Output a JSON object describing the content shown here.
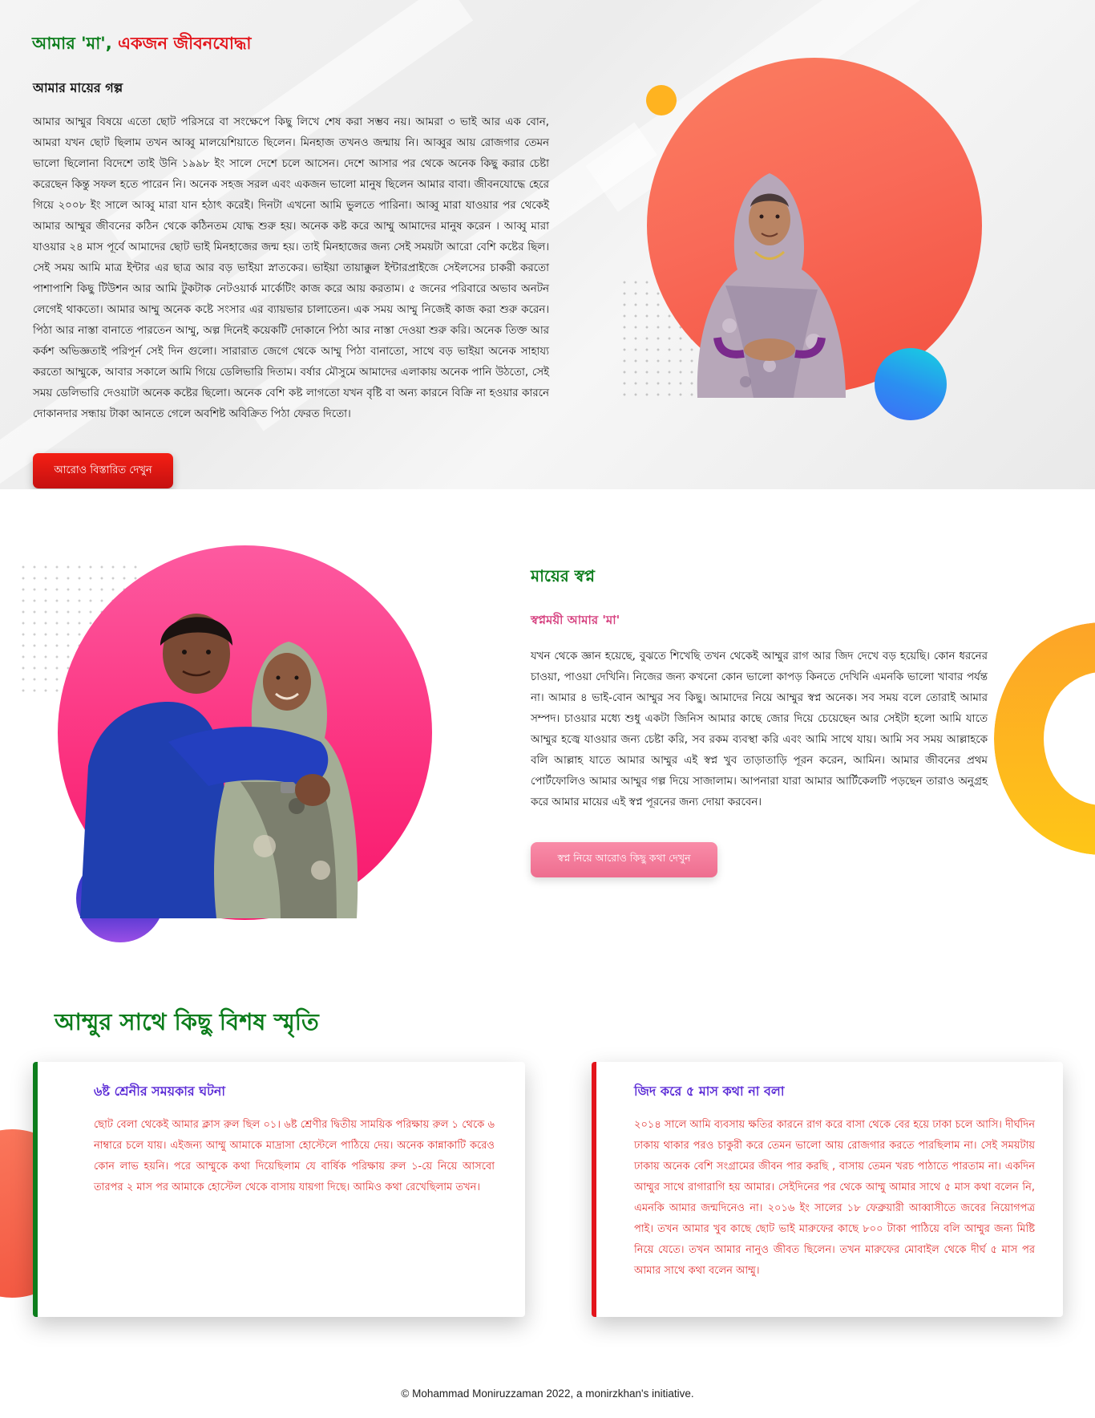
{
  "section1": {
    "headline_green": "আমার 'মা',",
    "headline_red": "একজন জীবনযোদ্ধা",
    "subtitle": "আমার মায়ের গল্প",
    "paragraph": "আমার আম্মুর বিষয়ে এতো ছোট পরিসরে বা সংক্ষেপে কিছু লিখে শেষ করা সম্ভব নয়। আমরা ৩ ভাই আর এক বোন, আমরা যখন ছোট ছিলাম তখন আব্বু মালয়েশিয়াতে ছিলেন। মিনহাজ তখনও জন্মায় নি। আব্বুর আয় রোজগার তেমন ভালো ছিলোনা বিদেশে তাই উনি ১৯৯৮ ইং সালে দেশে চলে আসেন। দেশে আসার পর থেকে অনেক কিছু করার চেষ্টা করেছেন কিন্তু সফল হতে পারেন নি। অনেক সহজ সরল এবং একজন ভালো মানুষ ছিলেন আমার বাবা। জীবনযোদ্ধে হেরে গিয়ে ২০০৮ ইং সালে আব্বু মারা যান হঠাৎ করেই। দিনটা এখনো আমি ভুলতে পারিনা। আব্বু মারা যাওয়ার পর থেকেই আমার আম্মুর জীবনের কঠিন থেকে কঠিনতম যোদ্ধ শুরু হয়। অনেক কষ্ট করে আম্মু আমাদের মানুষ করেন । আব্বু মারা যাওয়ার ২৪ মাস পূর্বে আমাদের ছোট ভাই মিনহাজের জন্ম হয়। তাই মিনহাজের জন্য সেই সময়টা আরো বেশি কষ্টের ছিল। সেই সময় আমি মাত্র ইন্টার এর ছাত্র আর বড় ভাইয়া স্নাতকের। ভাইয়া তায়াক্কুল ইন্টারপ্রাইজে সেইলসের চাকরী করতো পাশাপাশি কিছু টিউশন আর আমি টুকটাক নেটওয়ার্ক মার্কেটিং কাজ করে আয় করতাম। ৫ জনের পরিবারে অভাব অনটন লেগেই থাকতো। আমার আম্মু অনেক কষ্টে সংসার এর ব্যায়ভার চালাতেন। এক সময় আম্মু নিজেই কাজ করা শুরু করেন। পিঠা আর নাস্তা বানাতে পারতেন আম্মু, অল্প দিনেই কয়েকটি দোকানে পিঠা আর নাস্তা দেওয়া শুরু করি। অনেক তিক্ত আর কর্কশ অভিজ্ঞতাই পরিপূর্ন সেই দিন গুলো। সারারাত জেগে থেকে আম্মু পিঠা বানাতো, সাথে বড় ভাইয়া অনেক সাহায্য করতো আম্মুকে, আবার সকালে আমি গিয়ে ডেলিভারি দিতাম। বর্ষার মৌসুমে আমাদের এলাকায় অনেক পানি উঠতো, সেই সময় ডেলিভারি দেওয়াটা অনেক কষ্টের ছিলো। অনেক বেশি কষ্ট লাগতো যখন বৃষ্টি বা অন্য কারনে বিক্রি না হওয়ার কারনে দোকানদার সন্ধায় টাকা আনতে গেলে অবশিষ্ট অবিক্রিত পিঠা ফেরত দিতো।",
    "button": "আরোও বিস্তারিত দেখুন"
  },
  "section2": {
    "title": "মায়ের স্বপ্ন",
    "subtitle": "স্বপ্নময়ী আমার 'মা'",
    "paragraph": "যখন থেকে জ্ঞান হয়েছে, বুঝতে শিখেছি তখন থেকেই আম্মুর রাগ আর জিদ দেখে বড় হয়েছি। কোন ধরনের চাওয়া, পাওয়া দেখিনি। নিজের জন্য কখনো কোন ভালো কাপড় কিনতে দেখিনি এমনকি ভালো খাবার পর্যন্ত না। আমার ৪ ভাই-বোন আম্মুর সব কিছু। আমাদের নিয়ে আম্মুর স্বপ্ন অনেক। সব সময় বলে তোরাই আমার সম্পদ। চাওয়ার মধ্যে শুধু একটা জিনিস আমার কাছে জোর দিয়ে চেয়েছেন আর সেইটা হলো আমি যাতে আম্মুর হজ্বে যাওয়ার জন্য চেষ্টা করি, সব রকম ব্যবস্থা করি এবং আমি সাথে যায়। আমি সব সময় আল্লাহকে বলি আল্লাহ যাতে আমার আম্মুর এই স্বপ্ন খুব তাড়াতাড়ি পূরন করেন, আমিন। আমার জীবনের প্রথম পোর্টফোলিও আমার আম্মুর গল্প দিয়ে সাজালাম। আপনারা যারা আমার আর্টিকেলটি পড়ছেন তারাও অনুগ্রহ করে আমার মায়ের এই স্বপ্ন পূরনের জন্য দোয়া করবেন।",
    "button": "স্বপ্ন নিয়ে আরোও কিছু কথা দেখুন"
  },
  "section3": {
    "title": "আম্মুর সাথে কিছু বিশষ স্মৃতি",
    "cards": [
      {
        "title": "৬ষ্ট শ্রেনীর সময়কার ঘটনা",
        "body": "ছোট বেলা থেকেই আমার ক্লাস রুল ছিল ০১। ৬ষ্ট শ্রেণীর দ্বিতীয় সাময়িক পরিক্ষায় রুল ১ থেকে ৬ নাম্বারে চলে যায়। এইজন্য আম্মু আমাকে মাদ্রাসা হোস্টেলে পাঠিয়ে দেয়। অনেক কান্নাকাটি করেও কোন লাভ হয়নি। পরে আম্মুকে কথা দিয়েছিলাম যে বার্ষিক পরিক্ষায় রুল ১-য়ে নিয়ে আসবো তারপর ২ মাস পর আমাকে হোস্টেল থেকে বাসায় যায়গা দিছে। আমিও কথা রেখেছিলাম তখন।"
      },
      {
        "title": "জিদ করে ৫ মাস কথা না বলা",
        "body": "২০১৪ সালে আমি ব্যবসায় ক্ষতির কারনে রাগ করে বাসা থেকে বের হয়ে ঢাকা চলে আসি। দীর্ঘদিন ঢাকায় থাকার পরও চাকুরী করে তেমন ভালো আয় রোজগার করতে পারছিলাম না। সেই সময়টায় ঢাকায় অনেক বেশি সংগ্রামের জীবন পার করছি , বাসায় তেমন খরচ পাঠাতে পারতাম না। একদিন আম্মুর সাথে রাগারাগি হয় আমার। সেইদিনের পর থেকে আম্মু আমার সাথে ৫ মাস কথা বলেন নি, এমনকি আমার জন্মদিনেও না। ২০১৬ ইং সালের ১৮ ফেব্রুয়ারী আব্বাসীতে জবের নিয়োগপত্র পাই। তখন আমার খুব কাছে ছোট ভাই মারুফের কাছে ৮০০ টাকা পাঠিয়ে বলি আম্মুর জন্য মিষ্টি নিয়ে যেতে। তখন আমার নানুও জীবত ছিলেন। তখন মারুফের মোবাইল থেকে দীর্ঘ ৫ মাস পর আমার সাথে কথা বলেন আম্মু।"
      }
    ]
  },
  "footer": "© Mohammad Moniruzzaman 2022, a monirzkhan's initiative.",
  "colors": {
    "green": "#0c7d1c",
    "red": "#e3141b",
    "pink": "#fb2f7d",
    "orange": "#f96a58",
    "purple": "#5b2bd6"
  },
  "icons": {
    "mother_photo": "portrait-photo",
    "mother_son_photo": "portrait-photo"
  }
}
